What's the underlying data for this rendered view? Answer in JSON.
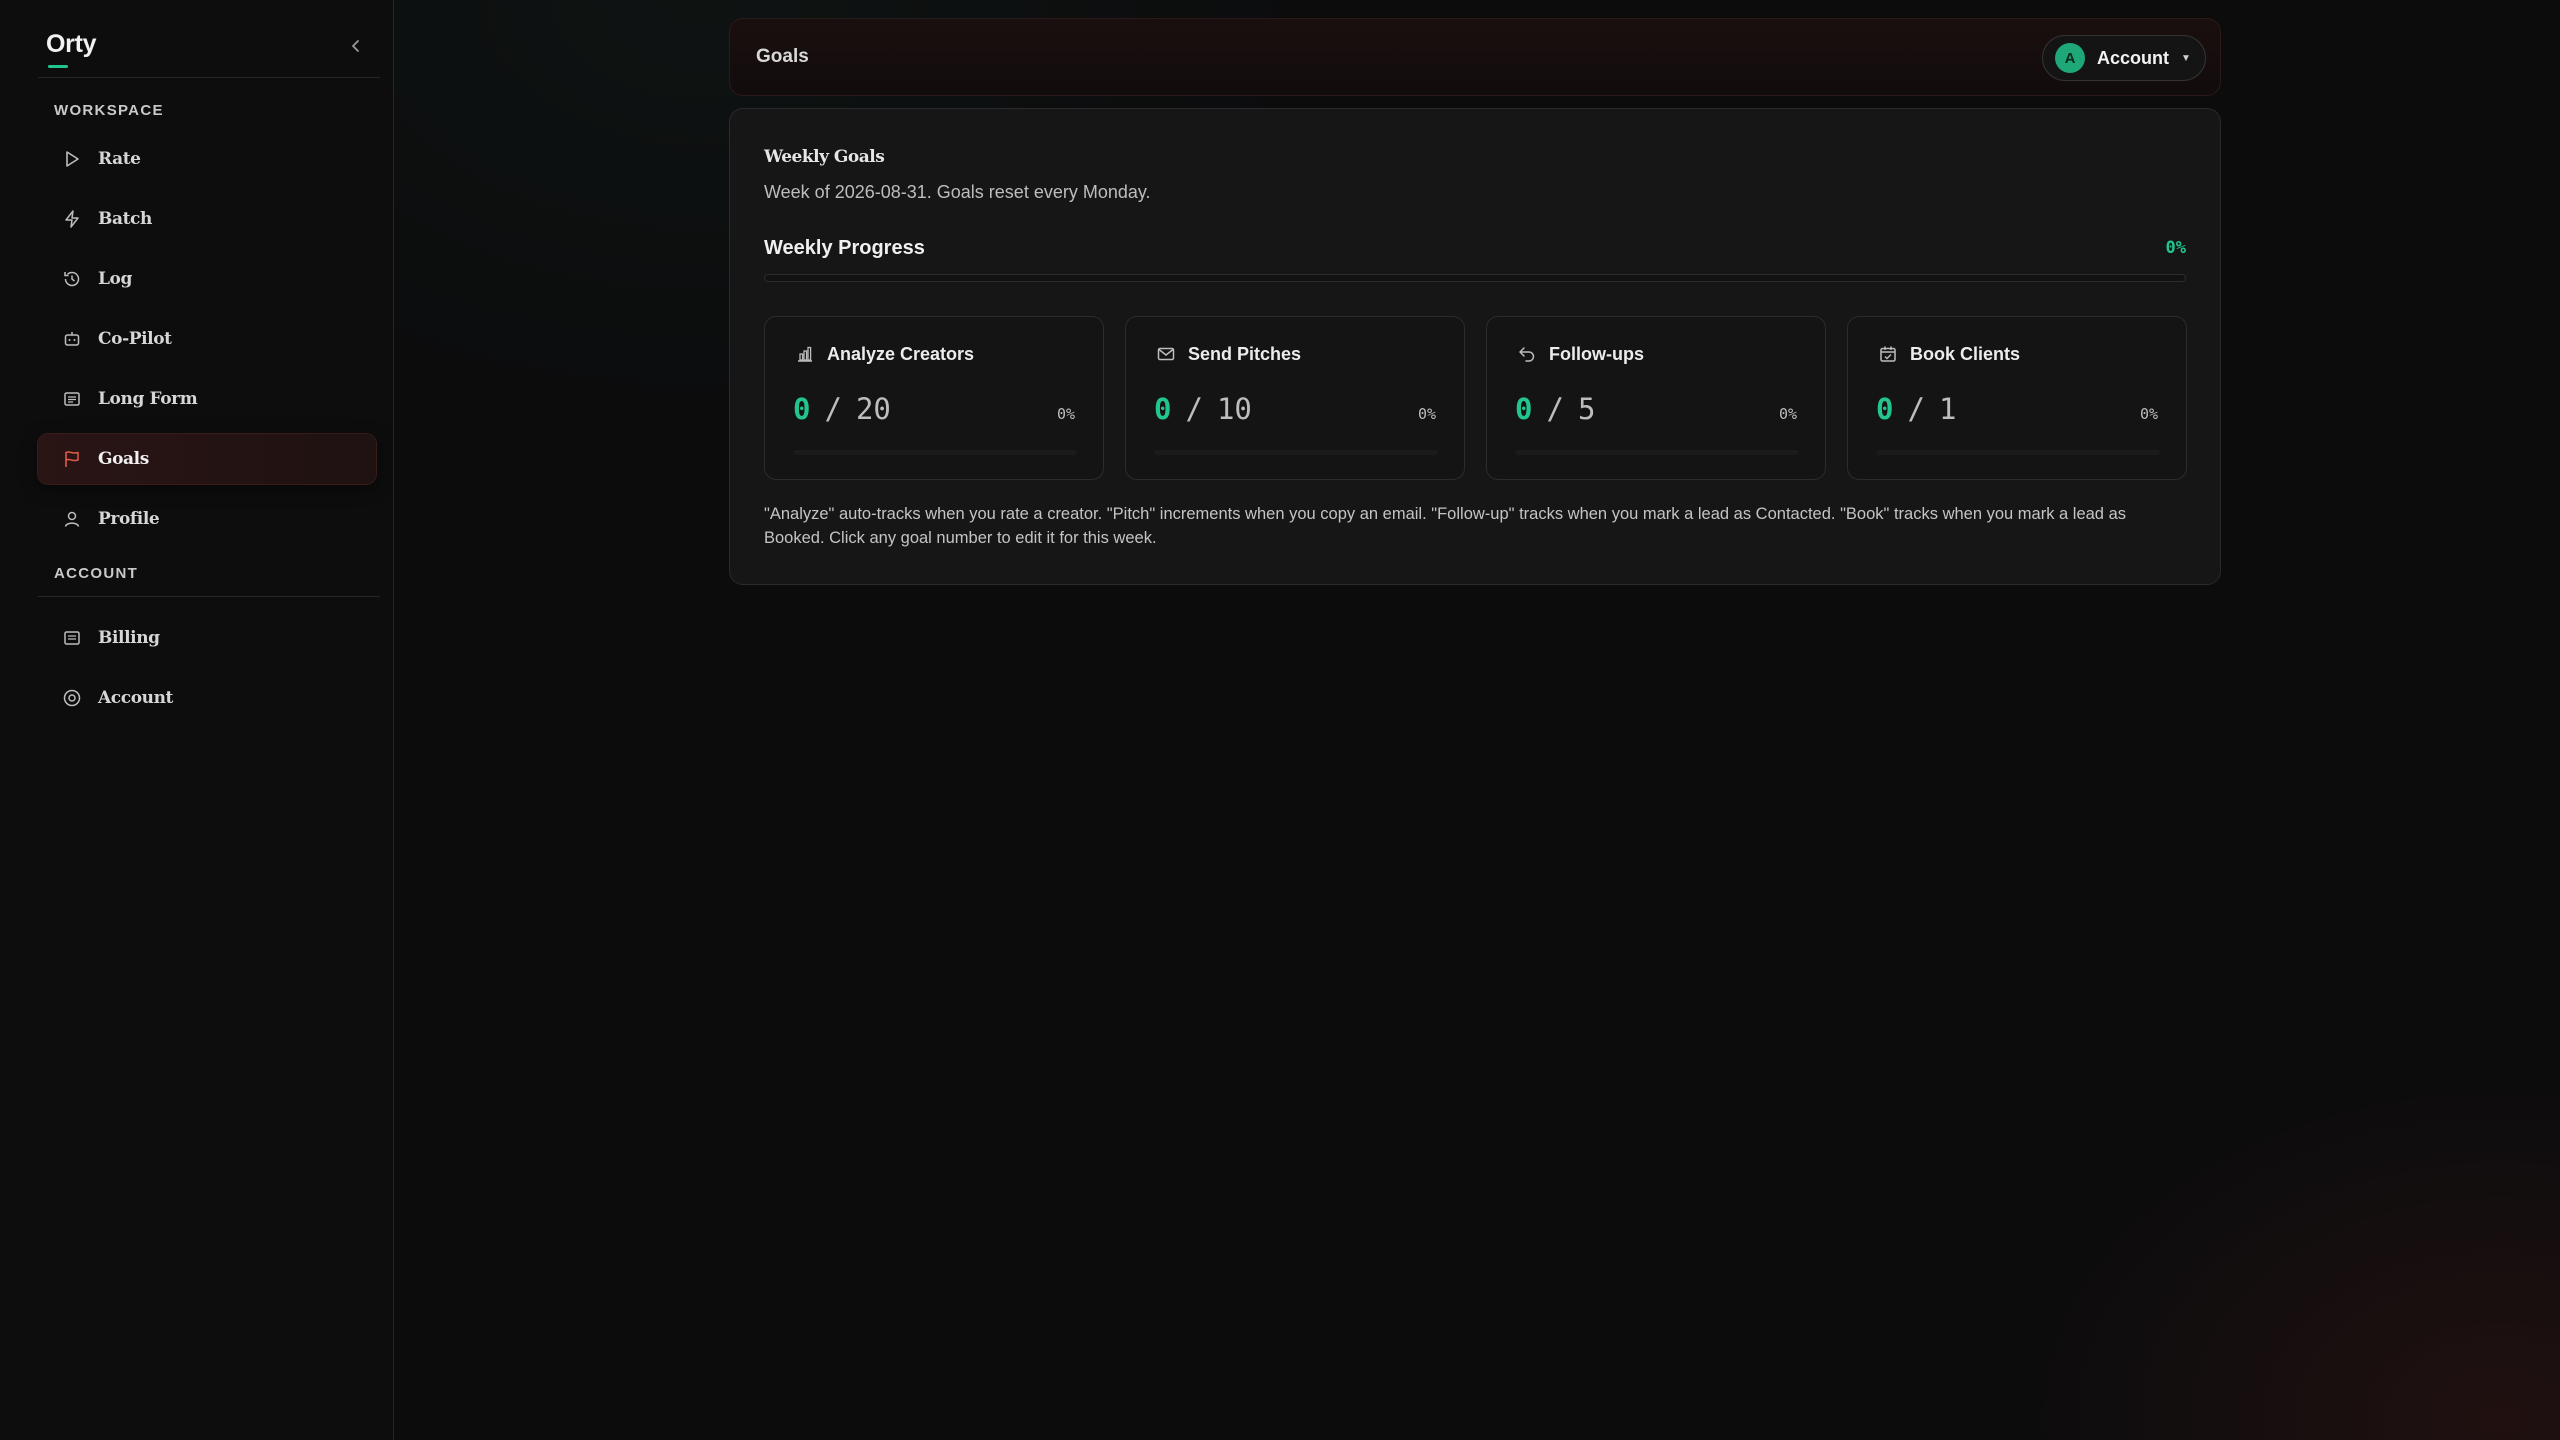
{
  "app": {
    "name": "Orty"
  },
  "sidebar": {
    "workspace_label": "WORKSPACE",
    "account_label": "ACCOUNT",
    "workspace_items": [
      {
        "label": "Rate",
        "icon": "play-icon"
      },
      {
        "label": "Batch",
        "icon": "bolt-icon"
      },
      {
        "label": "Log",
        "icon": "history-icon"
      },
      {
        "label": "Co-Pilot",
        "icon": "bot-icon"
      },
      {
        "label": "Long Form",
        "icon": "document-icon"
      },
      {
        "label": "Goals",
        "icon": "flag-icon",
        "active": true
      },
      {
        "label": "Profile",
        "icon": "user-icon"
      }
    ],
    "account_items": [
      {
        "label": "Billing",
        "icon": "receipt-icon"
      },
      {
        "label": "Account",
        "icon": "user-circle-icon"
      }
    ]
  },
  "header": {
    "title": "Goals",
    "account_button": {
      "avatar_letter": "A",
      "label": "Account"
    }
  },
  "weekly_goals": {
    "title": "Weekly Goals",
    "subtitle": "Week of 2026-08-31. Goals reset every Monday.",
    "progress_title": "Weekly Progress",
    "progress_pct": "0%",
    "progress_fraction": 0,
    "goals": [
      {
        "name": "Analyze Creators",
        "icon": "bar-chart-icon",
        "current": "0",
        "separator": "/",
        "target": "20",
        "pct": "0%",
        "fraction": 0
      },
      {
        "name": "Send Pitches",
        "icon": "mail-icon",
        "current": "0",
        "separator": "/",
        "target": "10",
        "pct": "0%",
        "fraction": 0
      },
      {
        "name": "Follow-ups",
        "icon": "reply-icon",
        "current": "0",
        "separator": "/",
        "target": "5",
        "pct": "0%",
        "fraction": 0
      },
      {
        "name": "Book Clients",
        "icon": "calendar-check-icon",
        "current": "0",
        "separator": "/",
        "target": "1",
        "pct": "0%",
        "fraction": 0
      }
    ],
    "note": "\"Analyze\" auto-tracks when you rate a creator. \"Pitch\" increments when you copy an email. \"Follow-up\" tracks when you mark a lead as Contacted. \"Book\" tracks when you mark a lead as Booked. Click any goal number to edit it for this week."
  },
  "colors": {
    "accent": "#22c58e",
    "active_nav_bg": "#2a1414",
    "active_flag": "#e25a4a"
  }
}
